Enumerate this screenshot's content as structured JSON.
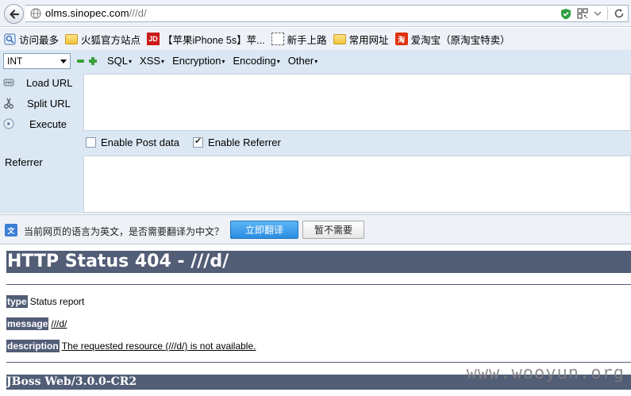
{
  "browser": {
    "url_host": "olms.sinopec.com",
    "url_path": "///d/"
  },
  "bookmarks": [
    {
      "label": "访问最多",
      "icon": "search-icon"
    },
    {
      "label": "火狐官方站点",
      "icon": "folder-icon"
    },
    {
      "label": "【苹果iPhone 5s】苹...",
      "icon": "jd-icon",
      "icon_text": "JD"
    },
    {
      "label": "新手上路",
      "icon": "dashed-box-icon"
    },
    {
      "label": "常用网址",
      "icon": "folder-icon"
    },
    {
      "label": "爱淘宝（原淘宝特卖）",
      "icon": "taobao-icon",
      "icon_text": "淘"
    }
  ],
  "hackbar": {
    "select_value": "INT",
    "menus": [
      "SQL",
      "XSS",
      "Encryption",
      "Encoding",
      "Other"
    ],
    "actions": [
      "Load URL",
      "Split URL",
      "Execute"
    ],
    "enable_post": "Enable Post data",
    "enable_referrer": "Enable Referrer",
    "referrer_label": "Referrer"
  },
  "translate": {
    "message": "当前网页的语言为英文，是否需要翻译为中文？",
    "translate_button": "立即翻译",
    "dismiss_button": "暂不需要"
  },
  "page": {
    "title": "HTTP Status 404 - ///d/",
    "type_key": "type",
    "type_value": "Status report",
    "message_key": "message",
    "message_value": "///d/",
    "description_key": "description",
    "description_value": "The requested resource (///d/) is not available.",
    "server": "JBoss Web/3.0.0-CR2"
  },
  "watermark": "www.wooyun.org",
  "colors": {
    "status_header": "#525d76",
    "hackbar_bg": "#dbe7f3",
    "translate_button": "#2a8ee2"
  }
}
